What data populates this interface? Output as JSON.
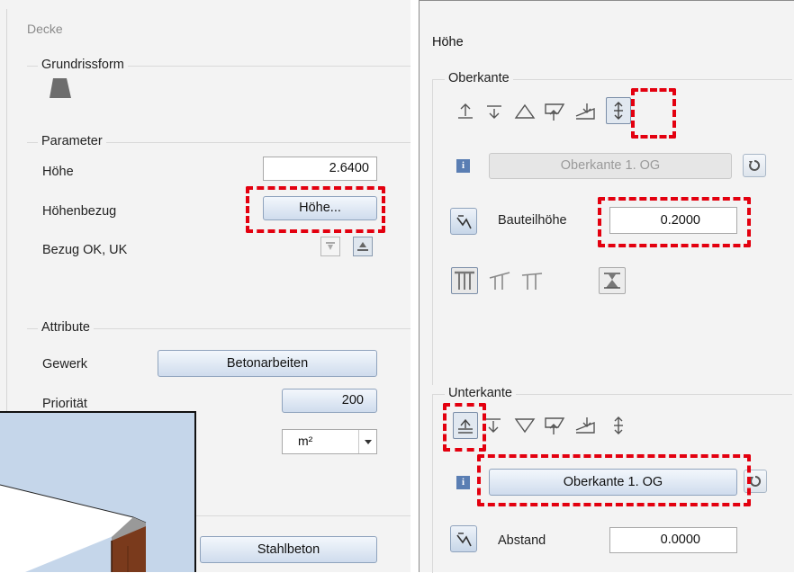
{
  "left_dialog": {
    "title": "Decke",
    "grundriss": {
      "label": "Grundrissform"
    },
    "parameter": {
      "label": "Parameter",
      "hoehe_label": "Höhe",
      "hoehe_value": "2.6400",
      "hoehenbezug_label": "Höhenbezug",
      "hoehenbezug_button": "Höhe...",
      "bezug_label": "Bezug OK, UK"
    },
    "attribute": {
      "label": "Attribute",
      "gewerk_label": "Gewerk",
      "gewerk_value": "Betonarbeiten",
      "prioritaet_label": "Priorität",
      "prioritaet_value": "200",
      "unit_value": "m²",
      "material_value": "Stahlbeton"
    }
  },
  "right_dialog": {
    "title": "Höhe",
    "oberkante": {
      "label": "Oberkante",
      "reference_button": "Oberkante 1. OG",
      "bauteilhoehe_label": "Bauteilhöhe",
      "bauteilhoehe_value": "0.2000"
    },
    "unterkante": {
      "label": "Unterkante",
      "reference_button": "Oberkante 1. OG",
      "abstand_label": "Abstand",
      "abstand_value": "0.0000"
    }
  },
  "colors": {
    "highlight_dash": "#e3000f",
    "button_blue": "#cfdced",
    "wall_brown": "#7a3a1c",
    "sky_blue": "#c5d6ea"
  }
}
